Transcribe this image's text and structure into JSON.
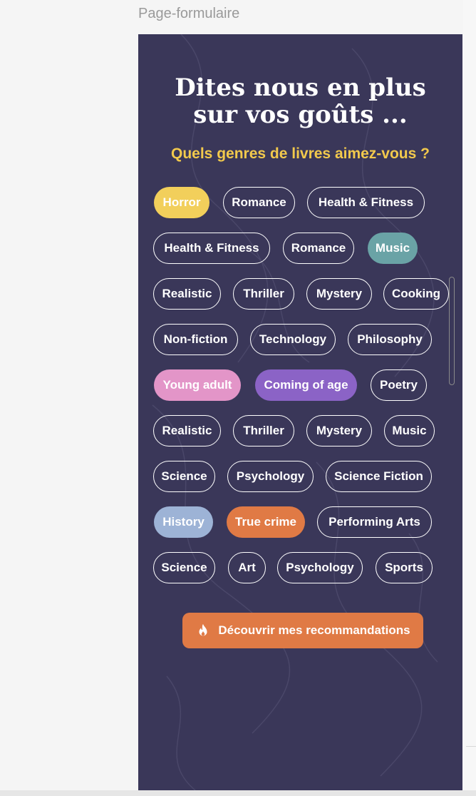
{
  "frame": {
    "label": "Page-formulaire"
  },
  "panel": {
    "title_line1": "Dites nous en plus",
    "title_line2": "sur vos goûts ...",
    "subtitle": "Quels genres de livres aimez-vous ?",
    "colors": {
      "background": "#3a3759",
      "subtitle": "#f2c94c"
    }
  },
  "chips": [
    {
      "label": "Horror",
      "selected": true,
      "color": "#f2cf5b"
    },
    {
      "label": "Romance",
      "selected": false
    },
    {
      "label": "Health & Fitness",
      "selected": false
    },
    {
      "label": "Health & Fitness",
      "selected": false
    },
    {
      "label": "Romance",
      "selected": false
    },
    {
      "label": "Music",
      "selected": true,
      "color": "#6aa3a6"
    },
    {
      "label": "Realistic",
      "selected": false
    },
    {
      "label": "Thriller",
      "selected": false
    },
    {
      "label": "Mystery",
      "selected": false
    },
    {
      "label": "Cooking",
      "selected": false
    },
    {
      "label": "Non-fiction",
      "selected": false
    },
    {
      "label": "Technology",
      "selected": false
    },
    {
      "label": "Philosophy",
      "selected": false
    },
    {
      "label": "Young adult",
      "selected": true,
      "color": "#e395c8"
    },
    {
      "label": "Coming of age",
      "selected": true,
      "color": "#8b63c6"
    },
    {
      "label": "Poetry",
      "selected": false
    },
    {
      "label": "Realistic",
      "selected": false
    },
    {
      "label": "Thriller",
      "selected": false
    },
    {
      "label": "Mystery",
      "selected": false
    },
    {
      "label": "Music",
      "selected": false
    },
    {
      "label": "Science",
      "selected": false
    },
    {
      "label": "Psychology",
      "selected": false
    },
    {
      "label": "Science Fiction",
      "selected": false
    },
    {
      "label": "History",
      "selected": true,
      "color": "#9db3d6"
    },
    {
      "label": "True crime",
      "selected": true,
      "color": "#e07a45"
    },
    {
      "label": "Performing Arts",
      "selected": false
    },
    {
      "label": "Science",
      "selected": false
    },
    {
      "label": "Art",
      "selected": false
    },
    {
      "label": "Psychology",
      "selected": false
    },
    {
      "label": "Sports",
      "selected": false
    }
  ],
  "cta": {
    "label": "Découvrir mes recommandations",
    "icon": "flame-icon",
    "color": "#e07a45"
  }
}
